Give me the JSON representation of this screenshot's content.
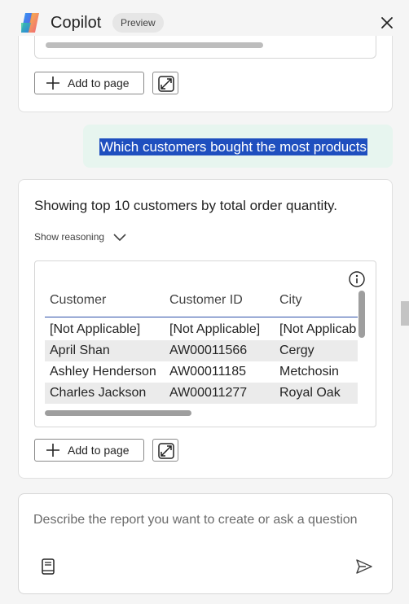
{
  "header": {
    "title": "Copilot",
    "badge": "Preview"
  },
  "icons": {
    "logo": "copilot-logo",
    "close": "close-icon"
  },
  "previous_card": {
    "add_to_page_label": "Add to page"
  },
  "user_message": "Which customers bought the most products",
  "response": {
    "summary": "Showing top 10 customers by total order quantity.",
    "reasoning_label": "Show reasoning",
    "table": {
      "columns": [
        "Customer",
        "Customer ID",
        "City"
      ],
      "rows": [
        [
          "[Not Applicable]",
          "[Not Applicable]",
          "[Not Applicab"
        ],
        [
          "April Shan",
          "AW00011566",
          "Cergy"
        ],
        [
          "Ashley Henderson",
          "AW00011185",
          "Metchosin"
        ],
        [
          "Charles Jackson",
          "AW00011277",
          "Royal Oak"
        ]
      ]
    },
    "add_to_page_label": "Add to page"
  },
  "composer": {
    "placeholder": "Describe the report you want to create or ask a question"
  },
  "colors": {
    "highlight": "#1f4fbf",
    "user_bubble": "#e7f5ef",
    "header_rule": "#2b4fa8"
  }
}
